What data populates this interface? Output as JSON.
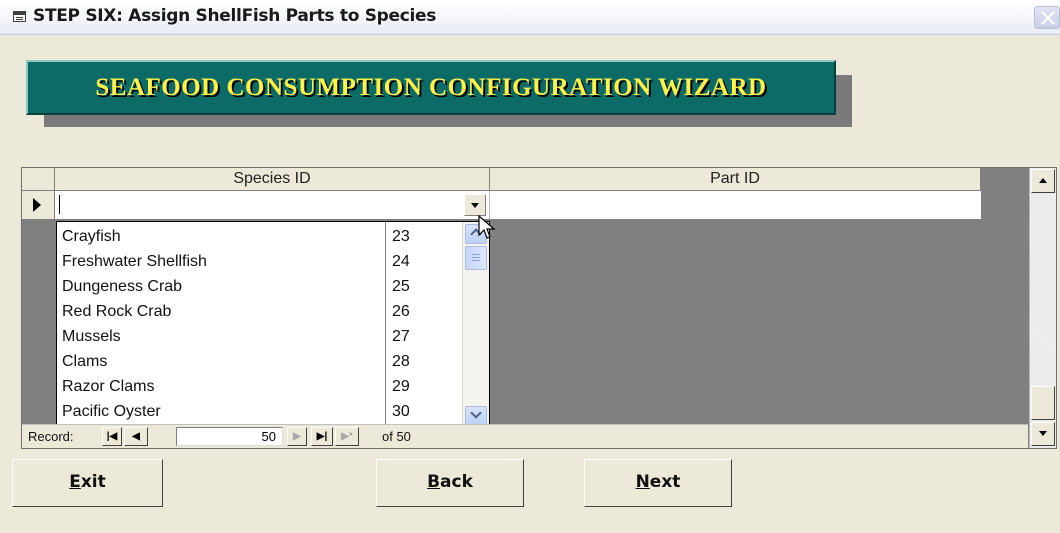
{
  "window": {
    "title": "STEP SIX:  Assign ShellFish Parts to Species"
  },
  "banner": {
    "text": "SEAFOOD CONSUMPTION CONFIGURATION WIZARD"
  },
  "grid": {
    "columns": [
      "Species ID",
      "Part ID"
    ],
    "species_value": "",
    "part_value": ""
  },
  "dropdown": {
    "items": [
      {
        "name": "Crayfish",
        "id": "23"
      },
      {
        "name": "Freshwater Shellfish",
        "id": "24"
      },
      {
        "name": "Dungeness Crab",
        "id": "25"
      },
      {
        "name": "Red Rock Crab",
        "id": "26"
      },
      {
        "name": "Mussels",
        "id": "27"
      },
      {
        "name": "Clams",
        "id": "28"
      },
      {
        "name": "Razor Clams",
        "id": "29"
      },
      {
        "name": "Pacific Oyster",
        "id": "30"
      }
    ]
  },
  "navigation": {
    "label": "Record:",
    "current": "50",
    "of_text": "of 50"
  },
  "buttons": {
    "exit": "Exit",
    "back": "Back",
    "next": "Next"
  },
  "colors": {
    "banner_bg": "#0d6b67",
    "banner_text": "#fff34a",
    "grid_bg": "#808080",
    "window_bg": "#ece9d8"
  }
}
